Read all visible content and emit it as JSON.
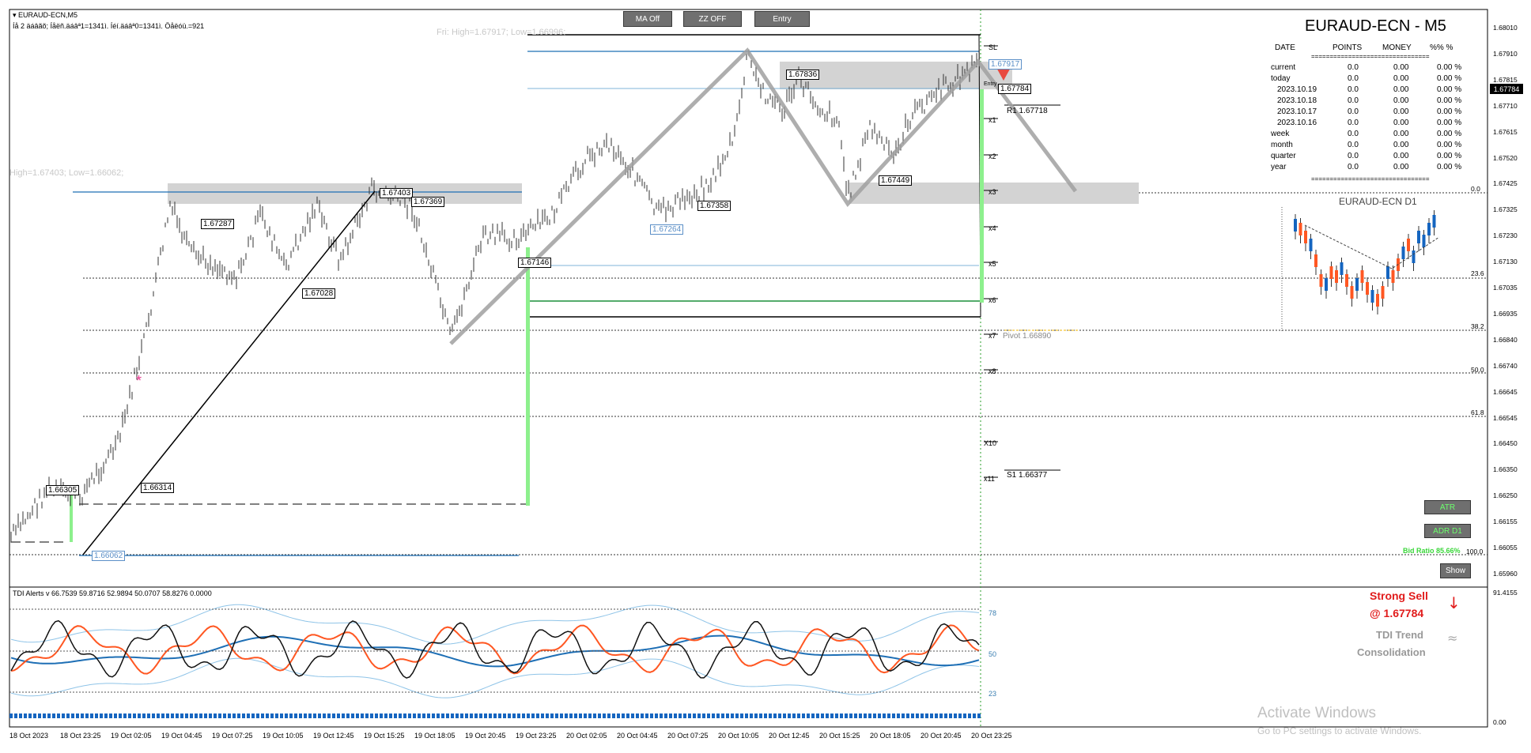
{
  "window": {
    "symbol_title": "▾ EURAUD-ECN,M5",
    "info_line": "Íå 2 äáâãõ; Íåëñ.äáâª1=1341ì. Íéí.äáâª0=1341ì. Öåëóü.=921"
  },
  "toolbar": {
    "ma_label": "MA Off",
    "zz_label": "ZZ OFF",
    "entry_label": "Entry"
  },
  "price_axis": [
    "1.68010",
    "1.67910",
    "1.67815",
    "1.67710",
    "1.67615",
    "1.67520",
    "1.67425",
    "1.67325",
    "1.67230",
    "1.67130",
    "1.67035",
    "1.66935",
    "1.66840",
    "1.66740",
    "1.66645",
    "1.66545",
    "1.66450",
    "1.66350",
    "1.66250",
    "1.66155",
    "1.66055",
    "1.65960"
  ],
  "current_price": "1.67784",
  "tdi_axis": [
    "91.4155",
    "0.00"
  ],
  "time_axis": [
    "18 Oct 2023",
    "18 Oct 23:25",
    "19 Oct 02:05",
    "19 Oct 04:45",
    "19 Oct 07:25",
    "19 Oct 10:05",
    "19 Oct 12:45",
    "19 Oct 15:25",
    "19 Oct 18:05",
    "19 Oct 20:45",
    "19 Oct 23:25",
    "20 Oct 02:05",
    "20 Oct 04:45",
    "20 Oct 07:25",
    "20 Oct 10:05",
    "20 Oct 12:45",
    "20 Oct 15:25",
    "20 Oct 18:05",
    "20 Oct 20:45",
    "20 Oct 23:25"
  ],
  "info_panel": {
    "title": "EURAUD-ECN - M5",
    "headers": {
      "date": "DATE",
      "points": "POINTS",
      "money": "MONEY",
      "pct": "%%  %"
    },
    "separator": "================================",
    "rows": [
      {
        "label": "current",
        "points": "0.0",
        "money": "0.00",
        "pct": "0.00 %"
      },
      {
        "label": "today",
        "points": "0.0",
        "money": "0.00",
        "pct": "0.00 %"
      },
      {
        "label": "2023.10.19",
        "points": "0.0",
        "money": "0.00",
        "pct": "0.00 %"
      },
      {
        "label": "2023.10.18",
        "points": "0.0",
        "money": "0.00",
        "pct": "0.00 %"
      },
      {
        "label": "2023.10.17",
        "points": "0.0",
        "money": "0.00",
        "pct": "0.00 %"
      },
      {
        "label": "2023.10.16",
        "points": "0.0",
        "money": "0.00",
        "pct": "0.00 %"
      },
      {
        "label": "week",
        "points": "0.0",
        "money": "0.00",
        "pct": "0.00 %"
      },
      {
        "label": "month",
        "points": "0.0",
        "money": "0.00",
        "pct": "0.00 %"
      },
      {
        "label": "quarter",
        "points": "0.0",
        "money": "0.00",
        "pct": "0.00 %"
      },
      {
        "label": "year",
        "points": "0.0",
        "money": "0.00",
        "pct": "0.00 %"
      }
    ]
  },
  "d1_title": "EURAUD-ECN D1",
  "high_low_fri": "Fri:  High=1.67917;  Low=1.66996;",
  "high_low_left": "High=1.67403;  Low=1.66062;",
  "chart_labels": {
    "p1": "1.67917",
    "p2": "1.67836",
    "p3": "1.67784",
    "p4": "1.67718",
    "p5": "1.67449",
    "p6": "1.67403",
    "p7": "1.67369",
    "p8": "1.67358",
    "p9": "1.67287",
    "p10": "1.67264",
    "p11": "1.67146",
    "p12": "1.67028",
    "p13": "1.66314",
    "p14": "1.66305",
    "p15": "1.66062",
    "r1": "R1 1.67718",
    "pivot": "Pivot 1.66890",
    "s1": "S1 1.66377"
  },
  "levels": {
    "sl": "SL",
    "entry": "Entry",
    "x1": "x1",
    "x2": "x2",
    "x3": "x3",
    "x4": "x4",
    "x5": "x5",
    "x6": "x6",
    "x7": "x7",
    "x8": "x8",
    "x10": "X10",
    "x11": "x11"
  },
  "retracement": {
    "r236": "23.6",
    "r382": "38.2",
    "r50": "50.0",
    "r618": "61.8",
    "r100": "100.0",
    "r0": "0.0"
  },
  "buttons": {
    "atr": "ATR",
    "adr": "ADR D1",
    "show": "Show"
  },
  "bid_ratio": "Bid Ratio 85.66%",
  "tdi": {
    "header": "TDI Alerts v 66.7539 59.8716 52.9894 50.0707 58.8276 0.0000",
    "lvl_78": "78",
    "lvl_50": "50",
    "lvl_23": "23",
    "signal": "Strong Sell",
    "signal_price": "@ 1.67784",
    "trend_label": "TDI Trend",
    "trend_value": "Consolidation"
  },
  "activate": {
    "title": "Activate Windows",
    "sub": "Go to PC settings to activate Windows."
  },
  "colors": {
    "bull_bar": "#1565c0",
    "bear_bar": "#ff5722",
    "accent_green": "#8df08d",
    "sell_red": "#e11c1c",
    "ma_blue": "#1e6fb5"
  }
}
